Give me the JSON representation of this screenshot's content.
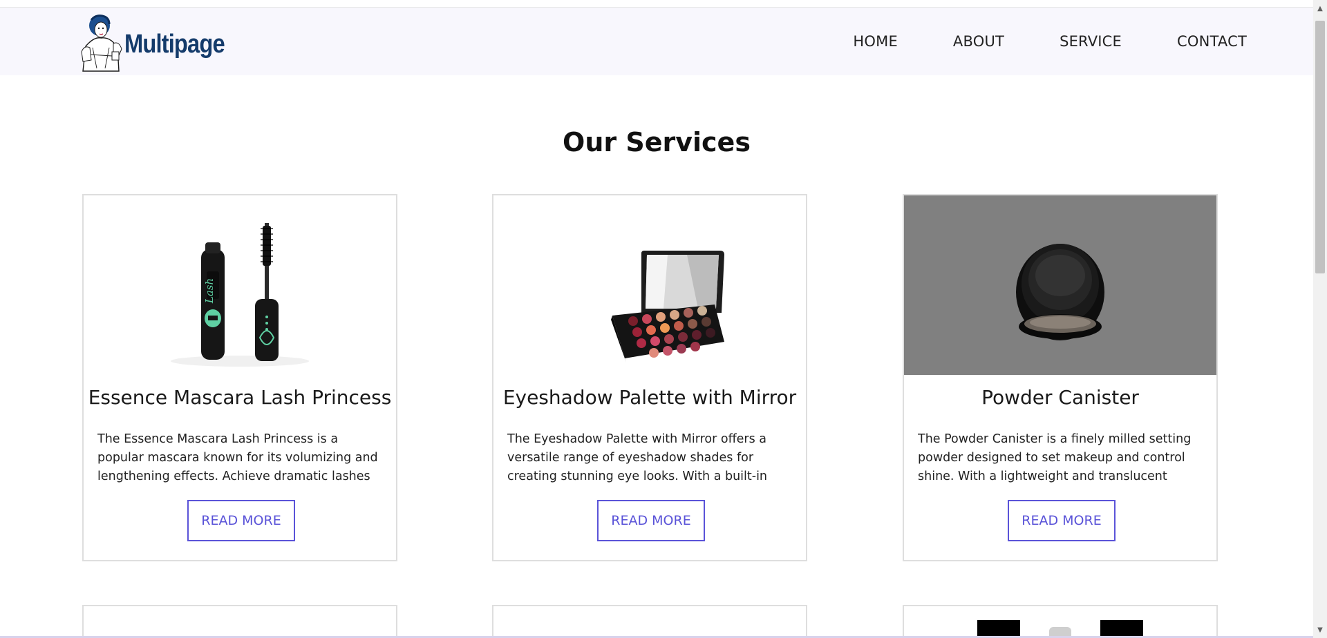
{
  "brand": {
    "logo_text": "Multipage"
  },
  "nav": {
    "home": "HOME",
    "about": "ABOUT",
    "service": "SERVICE",
    "contact": "CONTACT"
  },
  "page": {
    "title": "Our Services"
  },
  "cards": [
    {
      "title": "Essence Mascara Lash Princess",
      "description": "The Essence Mascara Lash Princess is a popular mascara known for its volumizing and lengthening effects. Achieve dramatic lashes with this long-...",
      "button": "READ MORE",
      "image_bg": "#ffffff"
    },
    {
      "title": "Eyeshadow Palette with Mirror",
      "description": "The Eyeshadow Palette with Mirror offers a versatile range of eyeshadow shades for creating stunning eye looks. With a built-in mirror, it's convenient for...",
      "button": "READ MORE",
      "image_bg": "#ffffff"
    },
    {
      "title": "Powder Canister",
      "description": "The Powder Canister is a finely milled setting powder designed to set makeup and control shine. With a lightweight and translucent formula, it...",
      "button": "READ MORE",
      "image_bg": "#808080"
    }
  ],
  "colors": {
    "accent": "#5a53d8",
    "header_bg": "#f8f7fd",
    "logo": "#143b6b"
  }
}
